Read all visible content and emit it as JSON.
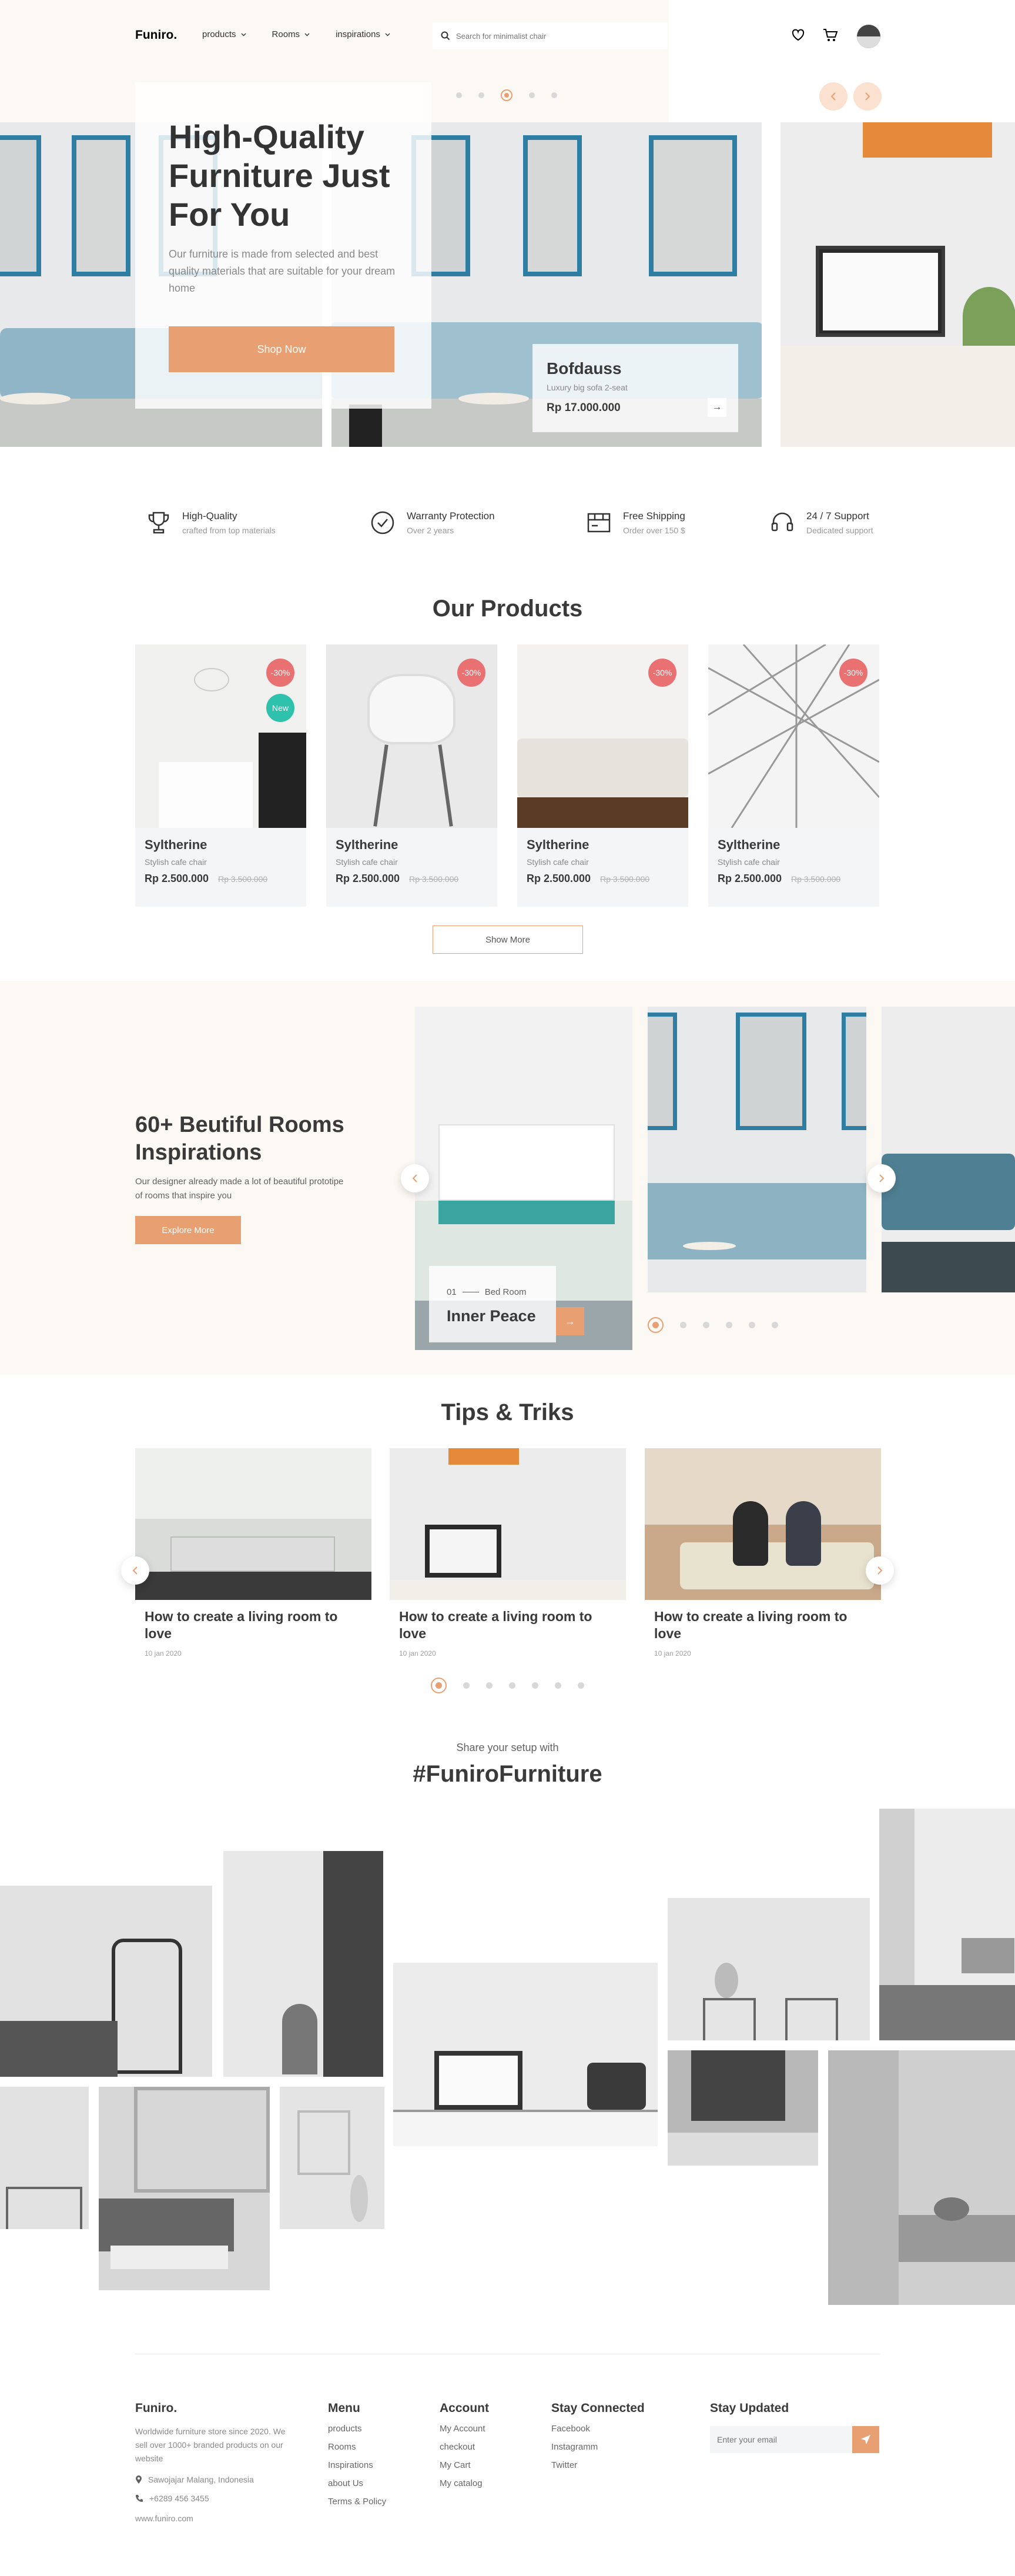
{
  "header": {
    "logo": "Funiro.",
    "nav": [
      {
        "label": "products"
      },
      {
        "label": "Rooms"
      },
      {
        "label": "inspirations"
      }
    ],
    "search_placeholder": "Search for minimalist chair"
  },
  "hero": {
    "title": "High-Quality Furniture Just For You",
    "subtitle": "Our furniture is made from selected and best quality materials that are suitable for your dream home",
    "cta": "Shop Now",
    "product": {
      "name": "Bofdauss",
      "desc": "Luxury big sofa 2-seat",
      "price": "Rp 17.000.000"
    },
    "arrow_glyph": "→"
  },
  "features": [
    {
      "title": "High-Quality",
      "sub": "crafted from top materials",
      "icon": "trophy-icon"
    },
    {
      "title": "Warranty Protection",
      "sub": "Over 2 years",
      "icon": "check-circle-icon"
    },
    {
      "title": "Free Shipping",
      "sub": "Order over 150 $",
      "icon": "shipping-icon"
    },
    {
      "title": "24 / 7 Support",
      "sub": "Dedicated support",
      "icon": "support-icon"
    }
  ],
  "products": {
    "title": "Our Products",
    "items": [
      {
        "name": "Syltherine",
        "desc": "Stylish cafe chair",
        "price": "Rp 2.500.000",
        "old": "Rp 3.500.000",
        "discount": "-30%",
        "new": "New"
      },
      {
        "name": "Syltherine",
        "desc": "Stylish cafe chair",
        "price": "Rp 2.500.000",
        "old": "Rp 3.500.000",
        "discount": "-30%"
      },
      {
        "name": "Syltherine",
        "desc": "Stylish cafe chair",
        "price": "Rp 2.500.000",
        "old": "Rp 3.500.000",
        "discount": "-30%"
      },
      {
        "name": "Syltherine",
        "desc": "Stylish cafe chair",
        "price": "Rp 2.500.000",
        "old": "Rp 3.500.000",
        "discount": "-30%"
      }
    ],
    "show_more": "Show More"
  },
  "rooms": {
    "title": "60+ Beutiful Rooms Inspirations",
    "desc": "Our designer already made a lot of beautiful prototipe of rooms that inspire you",
    "cta": "Explore More",
    "card_num": "01",
    "card_cat": "Bed Room",
    "card_name": "Inner Peace",
    "arrow_glyph": "→"
  },
  "tips": {
    "title": "Tips & Triks",
    "items": [
      {
        "title": "How to create a living room to love",
        "date": "10 jan 2020"
      },
      {
        "title": "How to create a living room to love",
        "date": "10 jan 2020"
      },
      {
        "title": "How to create a living room to love",
        "date": "10 jan 2020"
      }
    ]
  },
  "share": {
    "sub": "Share your setup with",
    "tag": "#FuniroFurniture"
  },
  "footer": {
    "brand": "Funiro.",
    "about": "Worldwide furniture store since 2020. We sell over 1000+ branded products on our website",
    "address": "Sawojajar Malang, Indonesia",
    "phone": "+6289 456 3455",
    "site": "www.funiro.com",
    "cols": [
      {
        "title": "Menu",
        "links": [
          "products",
          "Rooms",
          "Inspirations",
          "about Us",
          "Terms & Policy"
        ]
      },
      {
        "title": "Account",
        "links": [
          "My Account",
          "checkout",
          "My Cart",
          "My catalog"
        ]
      },
      {
        "title": "Stay Connected",
        "links": [
          "Facebook",
          "Instagramm",
          "Twitter"
        ]
      }
    ],
    "updated_title": "Stay Updated",
    "email_placeholder": "Enter your email"
  },
  "colors": {
    "accent": "#e89f71",
    "discount": "#e97171",
    "new": "#2ec1ac",
    "cream": "#fcf8f3"
  }
}
